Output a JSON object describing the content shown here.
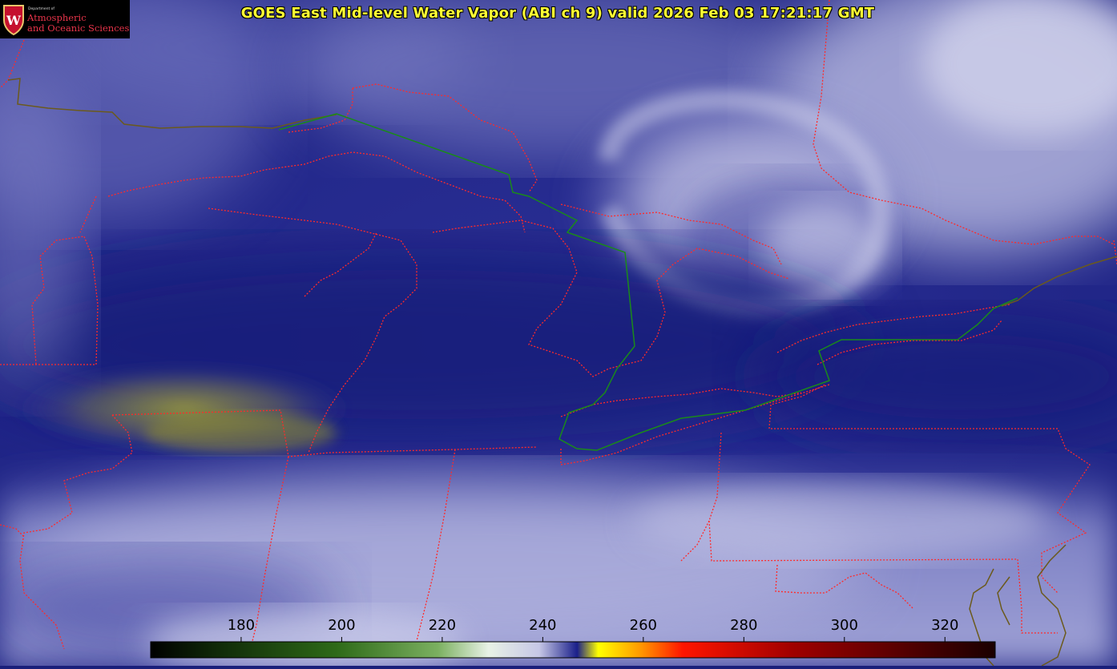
{
  "title": "GOES East Mid-level Water Vapor (ABI ch 9)  valid 2026 Feb 03 17:21:17 GMT",
  "logo": {
    "dept": "Department of",
    "line1": "Atmospheric",
    "line2": "and Oceanic Sciences"
  },
  "colorbar": {
    "ticks": [
      {
        "value": 180,
        "label": "180"
      },
      {
        "value": 200,
        "label": "200"
      },
      {
        "value": 220,
        "label": "220"
      },
      {
        "value": 240,
        "label": "240"
      },
      {
        "value": 260,
        "label": "260"
      },
      {
        "value": 280,
        "label": "280"
      },
      {
        "value": 300,
        "label": "300"
      },
      {
        "value": 320,
        "label": "320"
      }
    ],
    "min": 162,
    "max": 330
  }
}
